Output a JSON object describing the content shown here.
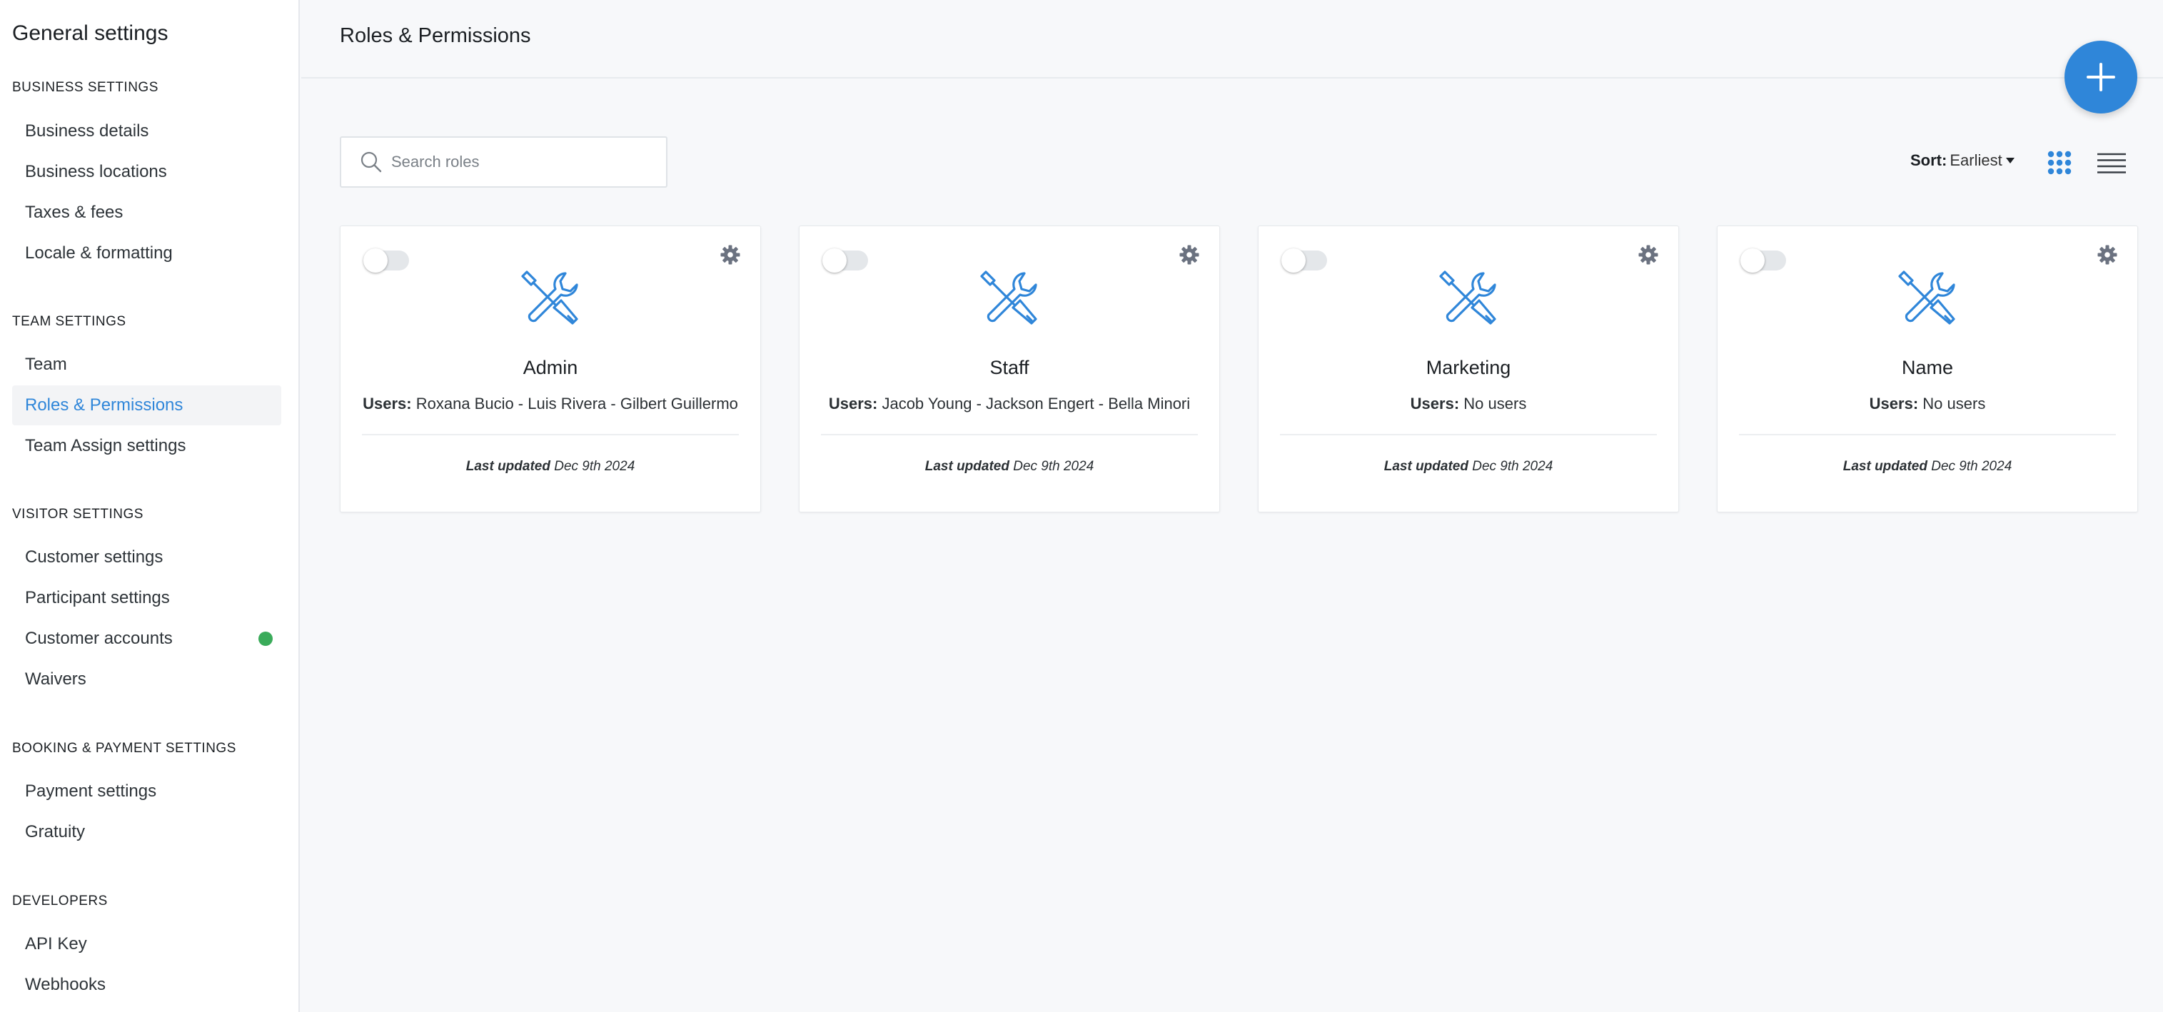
{
  "sidebar": {
    "title": "General settings",
    "sections": [
      {
        "heading": "BUSINESS SETTINGS",
        "items": [
          "Business details",
          "Business locations",
          "Taxes & fees",
          "Locale & formatting"
        ]
      },
      {
        "heading": "TEAM SETTINGS",
        "items": [
          "Team",
          "Roles & Permissions",
          "Team Assign settings"
        ]
      },
      {
        "heading": "VISITOR SETTINGS",
        "items": [
          "Customer settings",
          "Participant settings",
          "Customer accounts",
          "Waivers"
        ]
      },
      {
        "heading": "BOOKING & PAYMENT SETTINGS",
        "items": [
          "Payment settings",
          "Gratuity"
        ]
      },
      {
        "heading": "DEVELOPERS",
        "items": [
          "API Key",
          "Webhooks"
        ]
      }
    ],
    "active_item": "Roles & Permissions",
    "status_dot_item": "Customer accounts"
  },
  "header": {
    "title": "Roles & Permissions"
  },
  "toolbar": {
    "search_placeholder": "Search roles",
    "sort_label": "Sort:",
    "sort_value": "Earliest"
  },
  "roles": [
    {
      "name": "Admin",
      "users_label": "Users:",
      "users": "Roxana Bucio - Luis Rivera - Gilbert Guillermo",
      "updated_label": "Last updated",
      "updated": "Dec 9th 2024",
      "enabled": false
    },
    {
      "name": "Staff",
      "users_label": "Users:",
      "users": "Jacob Young - Jackson Engert - Bella Minori",
      "updated_label": "Last updated",
      "updated": "Dec 9th 2024",
      "enabled": false
    },
    {
      "name": "Marketing",
      "users_label": "Users:",
      "users": "No users",
      "updated_label": "Last updated",
      "updated": "Dec 9th 2024",
      "enabled": false
    },
    {
      "name": "Name",
      "users_label": "Users:",
      "users": "No users",
      "updated_label": "Last updated",
      "updated": "Dec 9th 2024",
      "enabled": false
    }
  ],
  "icons": {
    "add": "plus-icon",
    "search": "search-icon",
    "grid_view": "grid-view-icon",
    "list_view": "list-view-icon",
    "role": "tools-icon",
    "settings": "gear-icon",
    "sort_caret": "caret-down-icon"
  },
  "colors": {
    "accent": "#2f86d9",
    "status_dot": "#3aab5a",
    "active_bg": "#f3f4f6",
    "background": "#f7f8fa"
  }
}
